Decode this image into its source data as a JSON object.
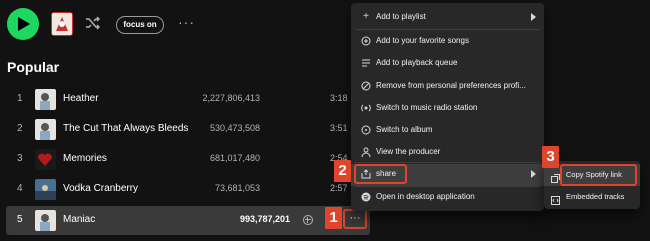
{
  "header": {
    "focus_label": "focus on",
    "more_label": "···"
  },
  "section_title": "Popular",
  "tracks": [
    {
      "num": "1",
      "name": "Heather",
      "plays": "2,227,806,413",
      "duration": "3:18"
    },
    {
      "num": "2",
      "name": "The Cut That Always Bleeds",
      "plays": "530,473,508",
      "duration": "3:51"
    },
    {
      "num": "3",
      "name": "Memories",
      "plays": "681,017,480",
      "duration": "2:54"
    },
    {
      "num": "4",
      "name": "Vodka Cranberry",
      "plays": "73,681,053",
      "duration": "2:57"
    },
    {
      "num": "5",
      "name": "Maniac",
      "plays": "993,787,201",
      "more": "···"
    }
  ],
  "context_menu": {
    "items": [
      {
        "label": "Add to playlist",
        "icon": "plus-icon",
        "submenu": true
      },
      {
        "label": "Add to your favorite songs",
        "icon": "plus-circle-icon"
      },
      {
        "label": "Add to playback queue",
        "icon": "queue-icon"
      },
      {
        "label": "Remove from personal preferences profi...",
        "icon": "remove-icon"
      },
      {
        "label": "Switch to music radio station",
        "icon": "radio-icon"
      },
      {
        "label": "Switch to album",
        "icon": "album-icon"
      },
      {
        "label": "View the producer",
        "icon": "person-icon"
      },
      {
        "label": "share",
        "icon": "share-icon",
        "submenu": true
      },
      {
        "label": "Open in desktop application",
        "icon": "spotify-icon"
      }
    ]
  },
  "share_submenu": {
    "items": [
      {
        "label": "Copy Spotify link",
        "icon": "copy-link-icon"
      },
      {
        "label": "Embedded tracks",
        "icon": "embed-icon"
      }
    ]
  },
  "step_badges": [
    "1",
    "2",
    "3"
  ],
  "colors": {
    "accent_green": "#1ed760",
    "annotation_red": "#e0442b",
    "menu_bg": "#282828",
    "page_bg": "#121212"
  }
}
